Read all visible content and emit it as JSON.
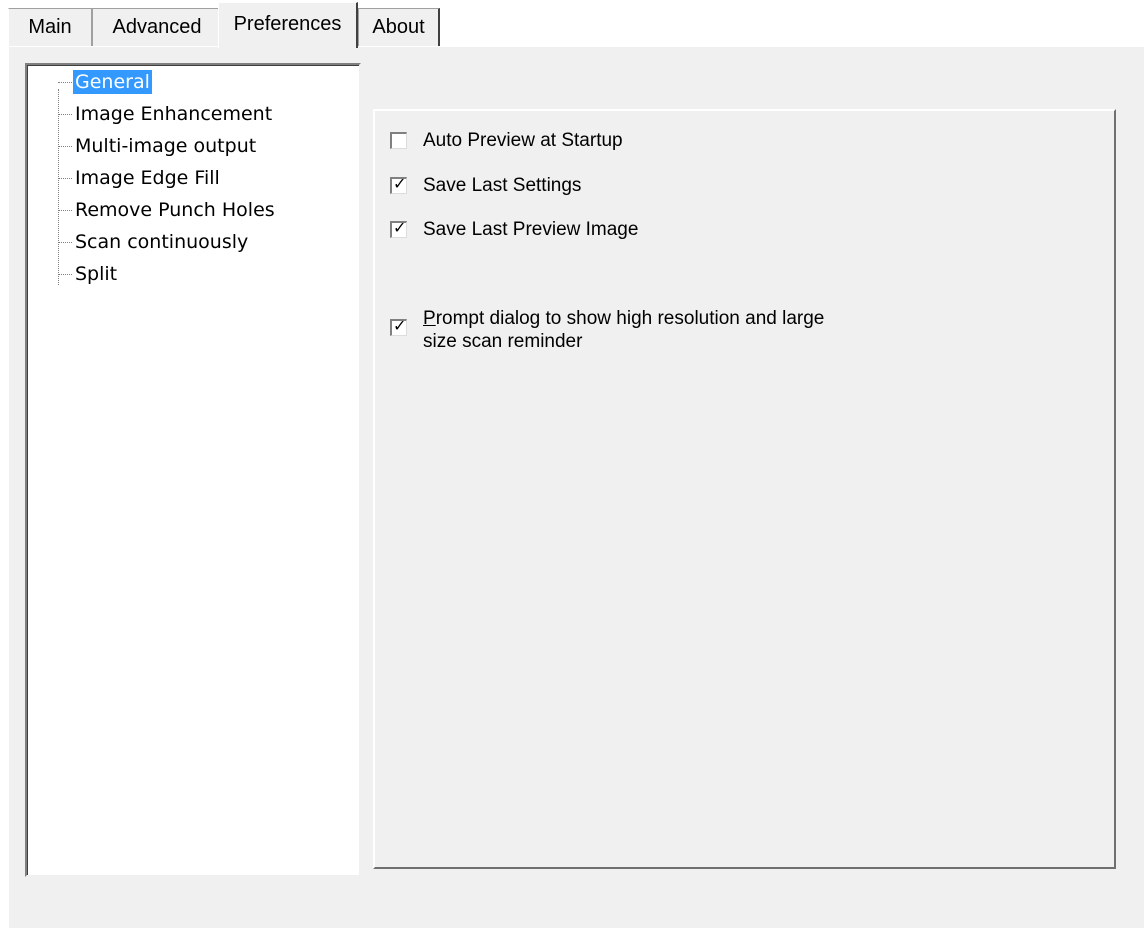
{
  "tabs": [
    {
      "label": "Main",
      "selected": false
    },
    {
      "label": "Advanced",
      "selected": false
    },
    {
      "label": "Preferences",
      "selected": true
    },
    {
      "label": "About",
      "selected": false
    }
  ],
  "tree": {
    "items": [
      {
        "label": "General",
        "selected": true
      },
      {
        "label": "Image Enhancement",
        "selected": false
      },
      {
        "label": "Multi-image output",
        "selected": false
      },
      {
        "label": "Image Edge Fill",
        "selected": false
      },
      {
        "label": "Remove Punch Holes",
        "selected": false
      },
      {
        "label": "Scan continuously",
        "selected": false
      },
      {
        "label": "Split",
        "selected": false
      }
    ]
  },
  "general": {
    "auto_preview": {
      "label": "Auto Preview at Startup",
      "checked": false
    },
    "save_settings": {
      "label": "Save Last Settings",
      "checked": true
    },
    "save_preview": {
      "label": "Save Last Preview Image",
      "checked": true
    },
    "prompt_dialog": {
      "accel": "P",
      "label_line1_rest": "rompt dialog to show high resolution and large",
      "label_line2": "size scan reminder",
      "checked": true
    }
  },
  "colors": {
    "selection": "#3399ff",
    "dialog_bg": "#f0f0f0"
  }
}
